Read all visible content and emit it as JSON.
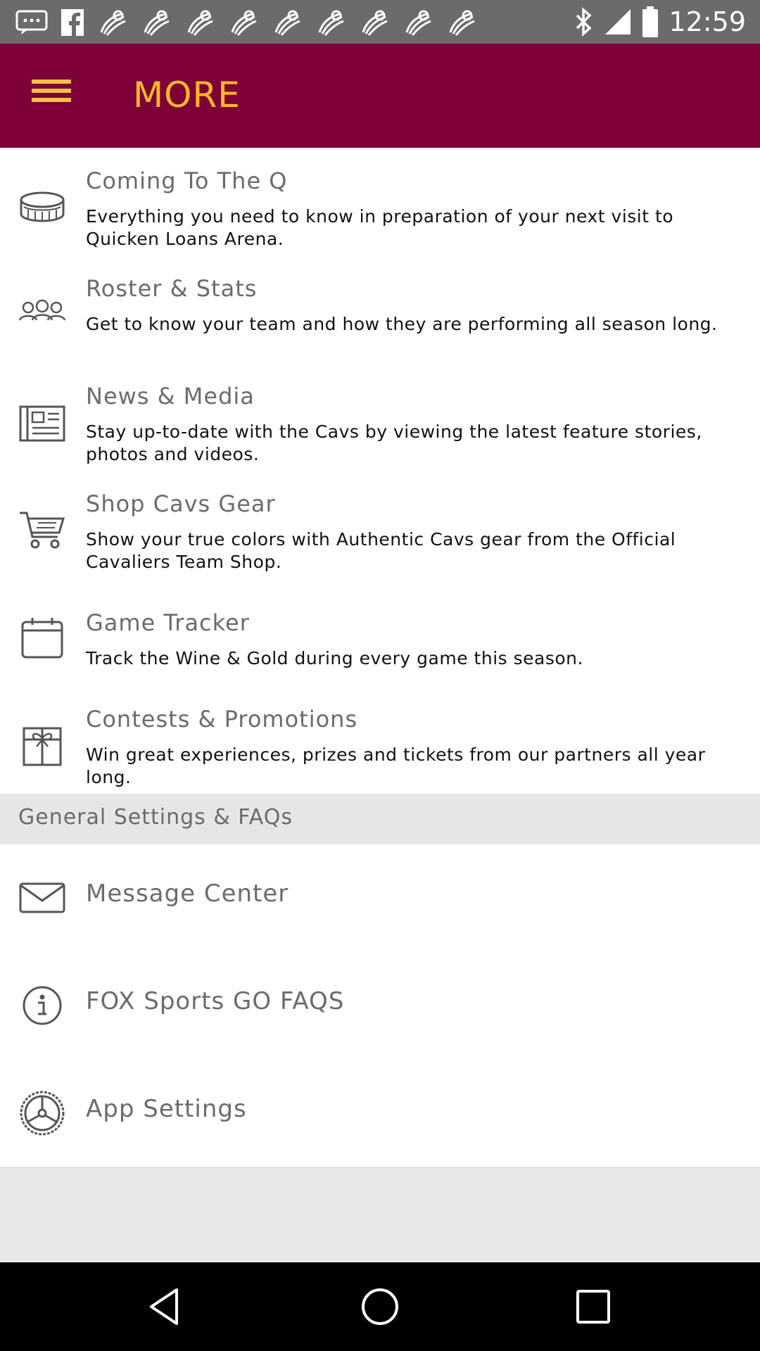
{
  "status_bar": {
    "time": "12:59",
    "notification_icons": [
      "message-icon",
      "facebook-icon",
      "app-icon",
      "app-icon",
      "app-icon",
      "app-icon",
      "app-icon",
      "app-icon",
      "app-icon",
      "app-icon",
      "app-icon"
    ],
    "right_icons": [
      "bluetooth-icon",
      "signal-icon",
      "battery-icon"
    ]
  },
  "app_bar": {
    "title": "MORE",
    "menu_icon": "hamburger-menu-icon",
    "background": "#7e0038",
    "title_color": "#fdb827"
  },
  "menu_items": [
    {
      "title": "Coming To The Q",
      "description": "Everything you need to know in preparation of your next visit to Quicken Loans Arena.",
      "icon": "arena-icon"
    },
    {
      "title": "Roster & Stats",
      "description": "Get to know your team and how they are performing all season long.",
      "icon": "team-icon"
    },
    {
      "title": "News & Media",
      "description": "Stay up-to-date with the Cavs by viewing the latest feature stories, photos and videos.",
      "icon": "newspaper-icon"
    },
    {
      "title": "Shop Cavs Gear",
      "description": "Show your true colors with Authentic Cavs gear from the Official Cavaliers Team Shop.",
      "icon": "cart-icon"
    },
    {
      "title": "Game Tracker",
      "description": "Track the Wine & Gold during every game this season.",
      "icon": "calendar-icon"
    },
    {
      "title": "Contests & Promotions",
      "description": "Win great experiences, prizes and tickets from our partners all year long.",
      "icon": "gift-icon"
    }
  ],
  "settings_section": {
    "header": "General Settings & FAQs",
    "items": [
      {
        "title": "Message Center",
        "icon": "envelope-icon"
      },
      {
        "title": "FOX Sports GO FAQS",
        "icon": "info-icon"
      },
      {
        "title": "App Settings",
        "icon": "settings-wheel-icon"
      }
    ]
  },
  "nav_bar": {
    "buttons": [
      "back-icon",
      "home-icon",
      "recents-icon"
    ]
  }
}
